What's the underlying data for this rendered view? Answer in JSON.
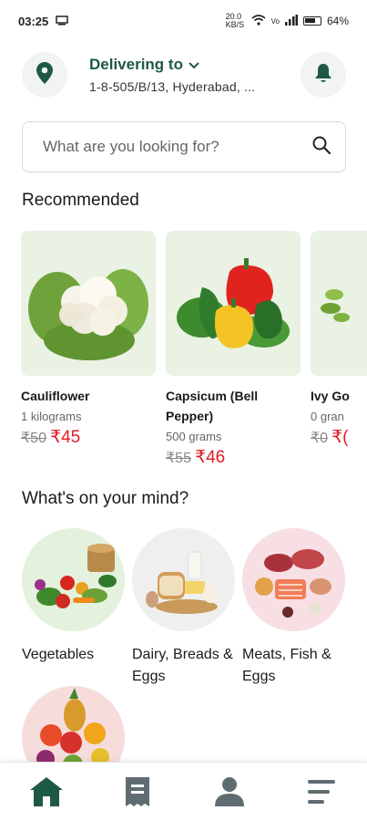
{
  "status_bar": {
    "time": "03:25",
    "network_speed": "20.0 KB/S",
    "battery": "64%"
  },
  "header": {
    "delivering_label": "Delivering to",
    "address": "1-8-505/B/13, Hyderabad, ..."
  },
  "search": {
    "placeholder": "What are you looking for?"
  },
  "recommended": {
    "title": "Recommended",
    "items": [
      {
        "name": "Cauliflower",
        "qty": "1 kilograms",
        "old_price": "₹50",
        "new_price": "₹45"
      },
      {
        "name": "Capsicum (Bell Pepper)",
        "qty": "500 grams",
        "old_price": "₹55",
        "new_price": "₹46"
      },
      {
        "name": "Ivy Go",
        "qty": "0 gran",
        "old_price": "₹0",
        "new_price": "₹("
      }
    ]
  },
  "categories": {
    "title": "What's on your mind?",
    "items": [
      {
        "label": "Vegetables"
      },
      {
        "label": "Dairy, Breads & Eggs"
      },
      {
        "label": "Meats, Fish & Eggs"
      },
      {
        "label": ""
      }
    ]
  },
  "colors": {
    "brand_green": "#1e5a43",
    "price_red": "#e01b24"
  }
}
